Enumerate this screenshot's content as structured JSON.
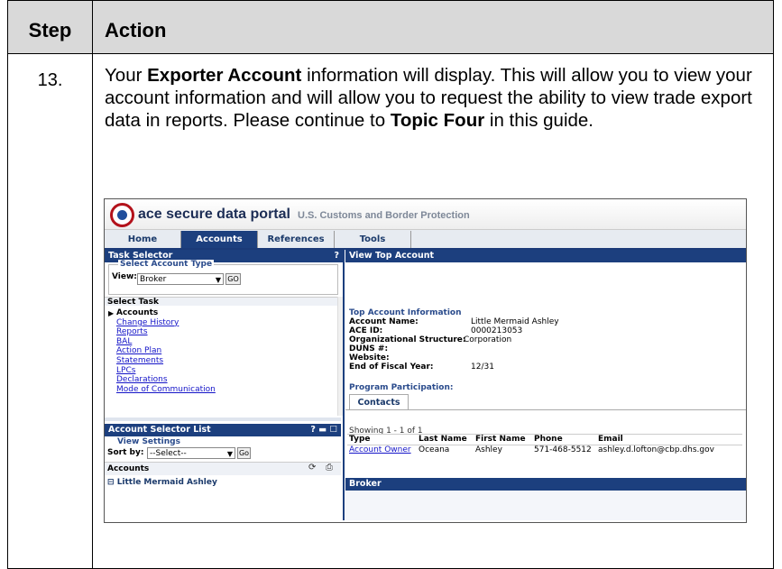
{
  "table": {
    "header_step": "Step",
    "header_action": "Action",
    "step_number": "13.",
    "para": {
      "t1": "Your ",
      "b1": "Exporter Account",
      "t2": " information will display. This will allow you to view your account information and will allow you to request the ability to view trade export data in reports. Please continue to ",
      "b2": "Topic Four",
      "t3": " in this guide."
    }
  },
  "screenshot": {
    "logo_text": "ace secure data portal",
    "logo_sub": "U.S. Customs and Border Protection",
    "nav_tabs": [
      "Home",
      "Accounts",
      "References",
      "Tools"
    ],
    "active_tab": "Accounts",
    "task_selector": {
      "title": "Task Selector",
      "help": "?",
      "legend": "Select Account Type",
      "view_label": "View:",
      "view_value": "Broker",
      "go": "GO",
      "select_task": "Select Task",
      "tasks": [
        "Accounts",
        "Change History",
        "Reports",
        "BAL",
        "Action Plan",
        "Statements",
        "LPCs",
        "Declarations",
        "Mode of Communication"
      ]
    },
    "account_selector": {
      "title": "Account Selector List",
      "controls": "? ▬ ☐",
      "view_settings": "View Settings",
      "sort_label": "Sort by:",
      "sort_value": "--Select--",
      "go": "Go",
      "accounts_label": "Accounts",
      "account_item": "Little Mermaid Ashley"
    },
    "view_top_account": {
      "title": "View Top Account",
      "section": "Top Account Information",
      "fields": [
        {
          "label": "Account Name:",
          "value": "Little Mermaid Ashley"
        },
        {
          "label": "ACE ID:",
          "value": "0000213053"
        },
        {
          "label": "Organizational Structure:",
          "value": "Corporation"
        },
        {
          "label": "DUNS #:",
          "value": ""
        },
        {
          "label": "Website:",
          "value": ""
        },
        {
          "label": "End of Fiscal Year:",
          "value": "12/31"
        }
      ],
      "program_participation": "Program Participation:",
      "contacts_tab": "Contacts",
      "showing": "Showing 1 - 1 of 1",
      "columns": [
        "Type",
        "Last Name",
        "First Name",
        "Phone",
        "Email"
      ],
      "row": {
        "type": "Account Owner",
        "last": "Oceana",
        "first": "Ashley",
        "phone": "571-468-5512",
        "email": "ashley.d.lofton@cbp.dhs.gov"
      },
      "broker_bar": "Broker"
    }
  }
}
